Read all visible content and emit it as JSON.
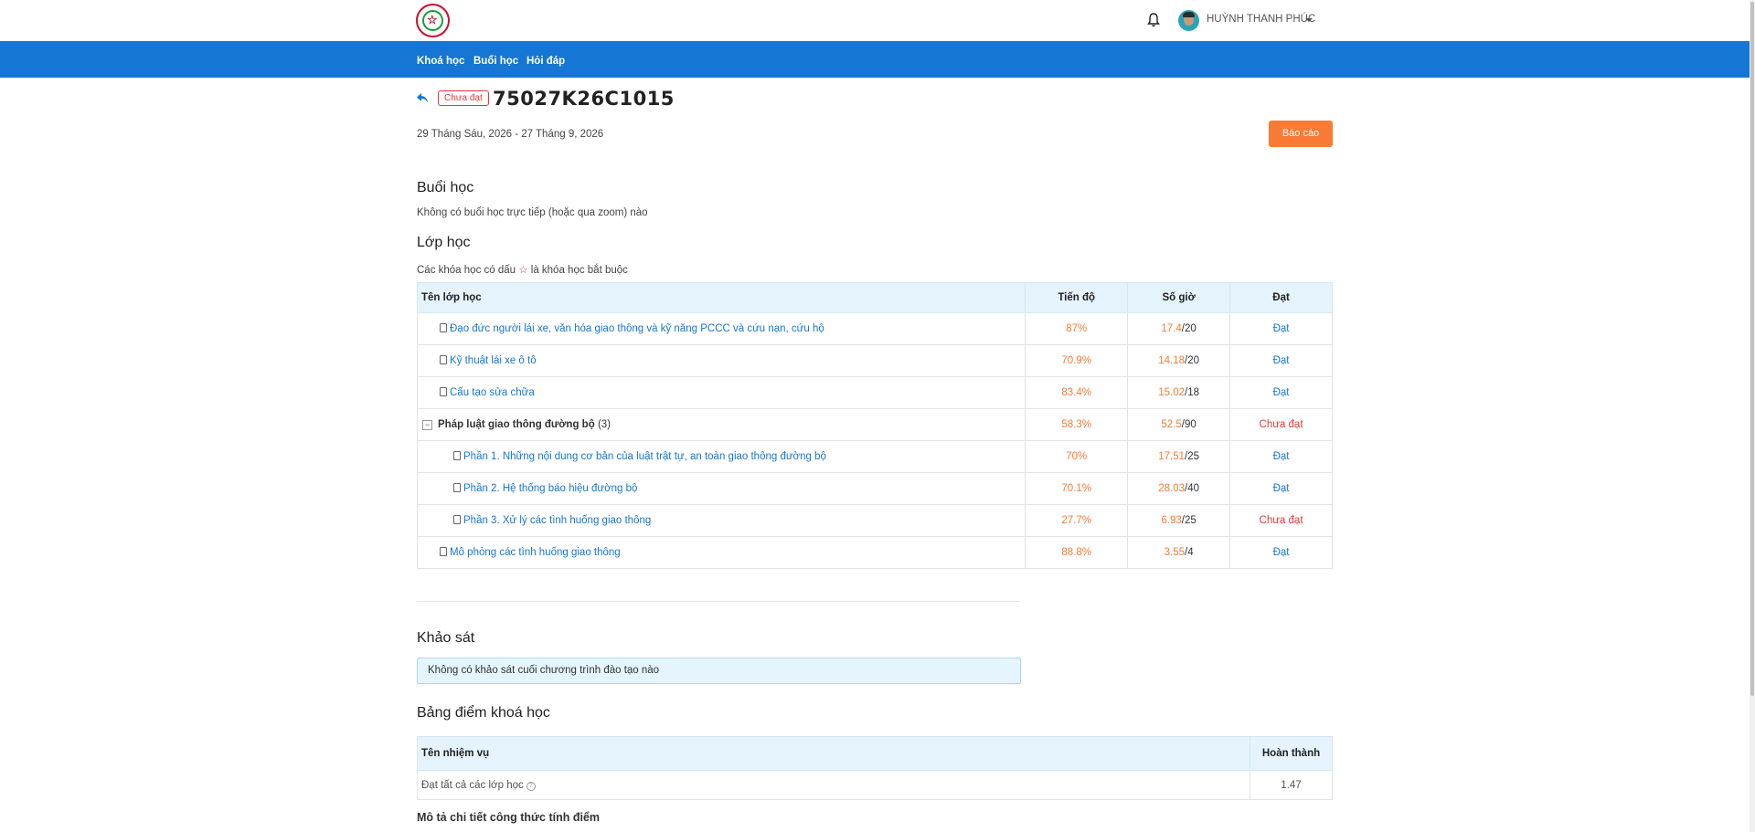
{
  "header": {
    "user_name": "HUỲNH THANH PHÚC"
  },
  "nav": {
    "items": [
      "Khoá học",
      "Buổi học",
      "Hỏi đáp"
    ]
  },
  "course": {
    "status_badge": "Chưa đạt",
    "code": "75027K26C1015",
    "dates": "29 Tháng Sáu, 2026 - 27 Tháng 9, 2026",
    "report_button": "Báo cáo"
  },
  "sessions": {
    "title": "Buổi học",
    "empty_text": "Không có buổi học trực tiếp (hoặc qua zoom) nào"
  },
  "classes": {
    "title": "Lớp học",
    "note_prefix": "Các khóa học có dấu",
    "note_suffix": "là khóa học bắt buộc",
    "columns": [
      "Tên lớp học",
      "Tiến độ",
      "Số giờ",
      "Đạt"
    ],
    "rows": [
      {
        "name": "Đạo đức người lái xe, văn hóa giao thông và kỹ năng PCCC và cứu nạn, cứu hộ",
        "progress": "87%",
        "hours_done": "17.4",
        "hours_total": "/20",
        "status": "Đạt"
      },
      {
        "name": "Kỹ thuật lái xe ô tô",
        "progress": "70.9%",
        "hours_done": "14.18",
        "hours_total": "/20",
        "status": "Đạt"
      },
      {
        "name": "Cấu tạo sửa chữa",
        "progress": "83.4%",
        "hours_done": "15.02",
        "hours_total": "/18",
        "status": "Đạt"
      },
      {
        "name": "Pháp luật giao thông đường bộ",
        "count": "(3)",
        "progress": "58.3%",
        "hours_done": "52.5",
        "hours_total": "/90",
        "status": "Chưa đạt"
      },
      {
        "name": "Phần 1. Những nội dung cơ bản của luật trật tự, an toàn giao thông đường bộ",
        "progress": "70%",
        "hours_done": "17.51",
        "hours_total": "/25",
        "status": "Đạt"
      },
      {
        "name": "Phần 2. Hệ thống báo hiệu đường bộ",
        "progress": "70.1%",
        "hours_done": "28.03",
        "hours_total": "/40",
        "status": "Đạt"
      },
      {
        "name": "Phần 3. Xử lý các tình huống giao thông",
        "progress": "27.7%",
        "hours_done": "6.93",
        "hours_total": "/25",
        "status": "Chưa đạt"
      },
      {
        "name": "Mô phỏng các tình huống giao thông",
        "progress": "88.8%",
        "hours_done": "3.55",
        "hours_total": "/4",
        "status": "Đạt"
      }
    ]
  },
  "survey": {
    "title": "Khảo sát",
    "empty_text": "Không có khảo sát cuối chương trình đào tạo nào"
  },
  "scores": {
    "title": "Bảng điểm khoá học",
    "columns": [
      "Tên nhiệm vụ",
      "Hoàn thành"
    ],
    "rows": [
      {
        "task": "Đạt tất cả các lớp học",
        "value": "1.47"
      }
    ],
    "detail_title": "Mô tả chi tiết công thức tính điểm"
  },
  "colors": {
    "nav_bg": "#1676d3",
    "accent_orange": "#f97a34",
    "fail_red": "#e53935",
    "link_blue": "#1676d3"
  }
}
